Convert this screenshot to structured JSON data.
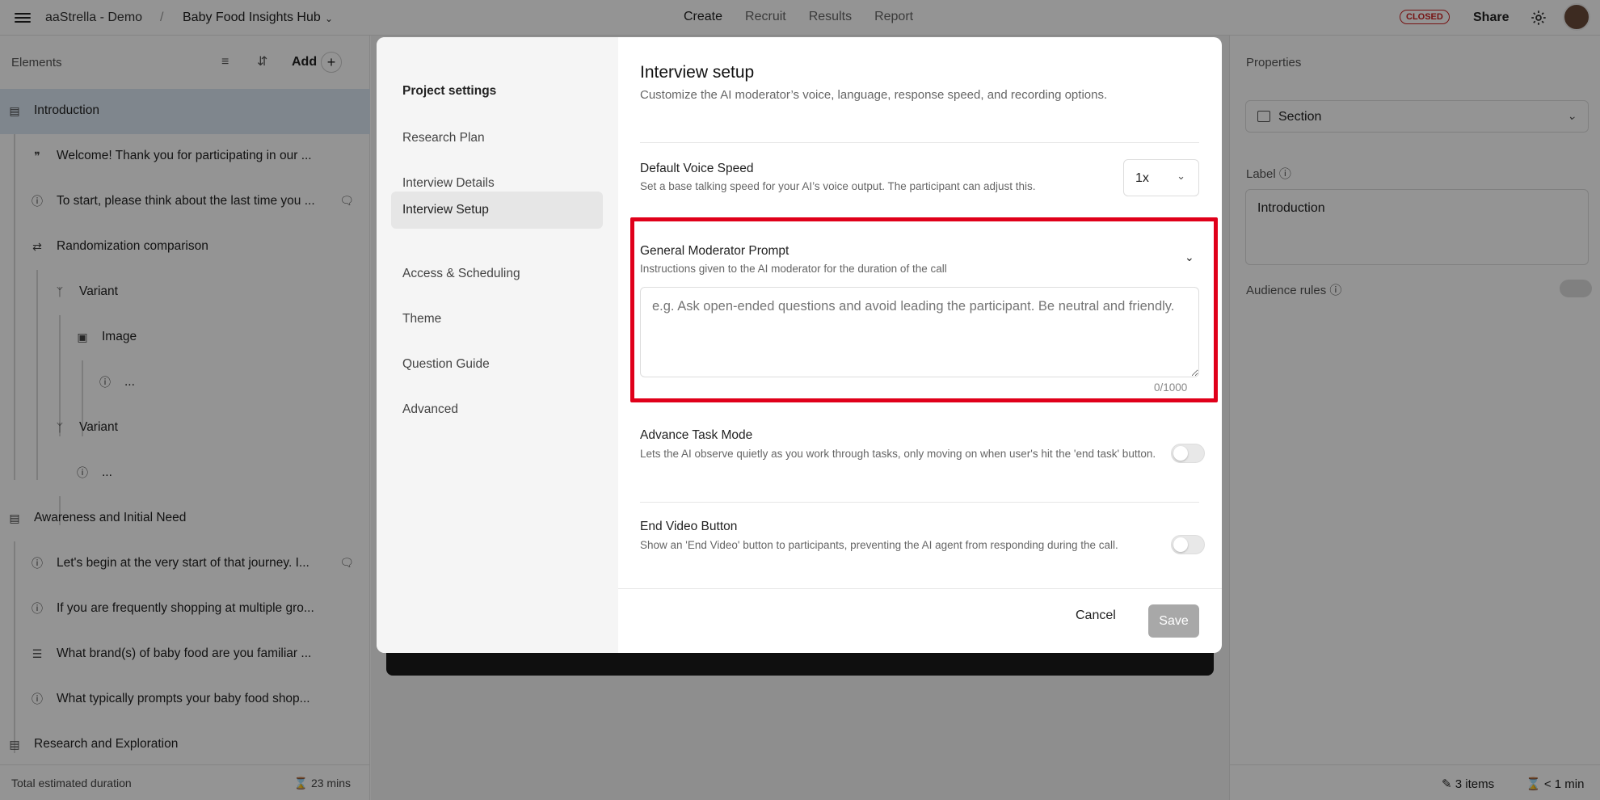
{
  "topbar": {
    "workspace": "aaStrella - Demo",
    "separator": "/",
    "project": "Baby Food Insights Hub",
    "tabs": [
      "Create",
      "Recruit",
      "Results",
      "Report"
    ],
    "active_tab": "Create",
    "status_badge": "CLOSED",
    "share_label": "Share"
  },
  "left_panel": {
    "title": "Elements",
    "add_label": "Add",
    "plus": "+",
    "items": [
      {
        "label": "Introduction",
        "icon": "section-icon"
      },
      {
        "label": "Welcome! Thank you for participating in our ...",
        "icon": "quote-icon"
      },
      {
        "label": "To start, please think about the last time you ...",
        "icon": "question-icon"
      },
      {
        "label": "Randomization comparison",
        "icon": "randomize-icon"
      },
      {
        "label": "Variant",
        "icon": "branch-icon"
      },
      {
        "label": "Image",
        "icon": "image-icon"
      },
      {
        "label": "...",
        "icon": "question-icon"
      },
      {
        "label": "Variant",
        "icon": "branch-icon"
      },
      {
        "label": "...",
        "icon": "question-icon"
      },
      {
        "label": "Awareness and Initial Need",
        "icon": "section-icon"
      },
      {
        "label": "Let's begin at the very start of that journey. I...",
        "icon": "question-icon"
      },
      {
        "label": "If you are frequently shopping at multiple gro...",
        "icon": "question-icon"
      },
      {
        "label": "What brand(s) of baby food are you familiar ...",
        "icon": "list-icon"
      },
      {
        "label": "What typically prompts your baby food shop...",
        "icon": "question-icon"
      },
      {
        "label": "Research and Exploration",
        "icon": "section-icon"
      }
    ],
    "footer_label": "Total estimated duration",
    "footer_value": "23 mins"
  },
  "right_panel": {
    "title": "Properties",
    "type_value": "Section",
    "label_title": "Label",
    "label_value": "Introduction",
    "audience_rules": "Audience rules",
    "footer_items": "3 items",
    "footer_time": "< 1 min"
  },
  "modal": {
    "nav": [
      "Project settings",
      "Research Plan",
      "Interview Details",
      "Interview Setup",
      "Access & Scheduling",
      "Theme",
      "Question Guide",
      "Advanced"
    ],
    "active_nav": "Interview Setup",
    "title": "Interview setup",
    "subtitle": "Customize the AI moderator’s voice, language, response speed, and recording options.",
    "voice_speed": {
      "title": "Default Voice Speed",
      "desc": "Set a base talking speed for your AI’s voice output. The participant can adjust this.",
      "value": "1x"
    },
    "prompt": {
      "title": "General Moderator Prompt",
      "desc": "Instructions given to the AI moderator for the duration of the call",
      "placeholder": "e.g. Ask open-ended questions and avoid leading the participant. Be neutral and friendly.",
      "counter": "0/1000"
    },
    "advance_task": {
      "title": "Advance Task Mode",
      "desc": "Lets the AI observe quietly as you work through tasks, only moving on when user's hit the 'end task' button.",
      "enabled": false
    },
    "end_video": {
      "title": "End Video Button",
      "desc": "Show an 'End Video' button to participants, preventing the AI agent from responding during the call.",
      "enabled": false
    },
    "cancel_label": "Cancel",
    "save_label": "Save"
  },
  "colors": {
    "highlight": "#e0001a",
    "selected_row": "#dbe7f3",
    "save_disabled": "#a8a8a8"
  }
}
